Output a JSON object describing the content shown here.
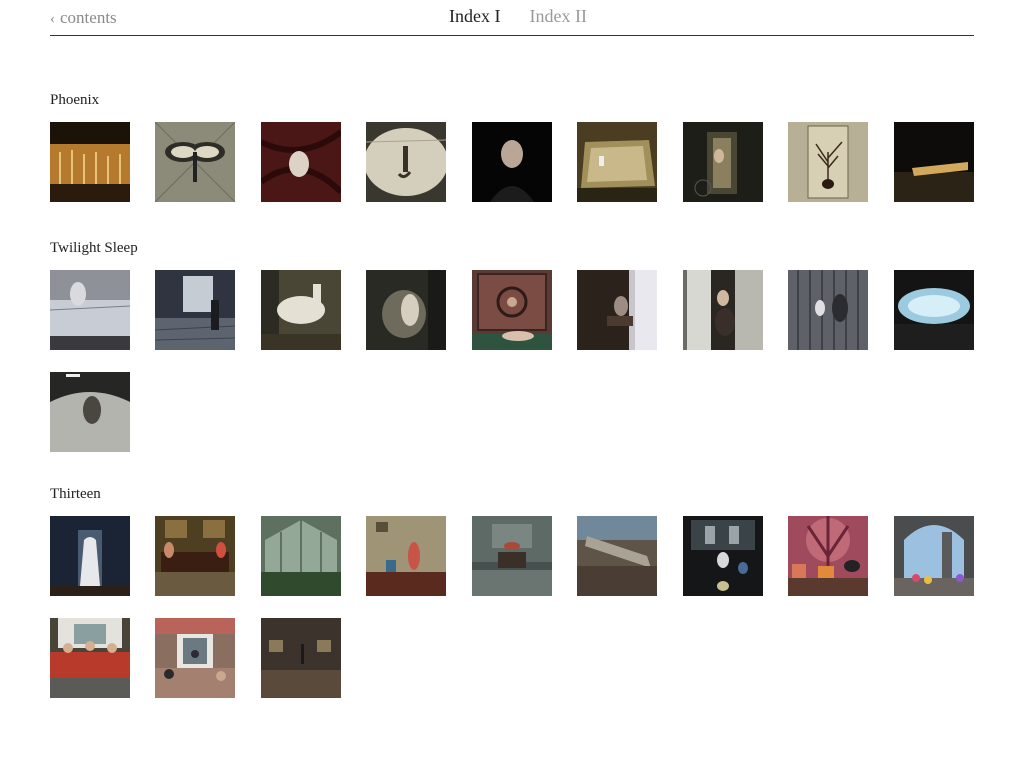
{
  "header": {
    "back_label": "contents",
    "back_icon": "chevron-left-icon",
    "tabs": [
      {
        "label": "Index I",
        "active": true
      },
      {
        "label": "Index II",
        "active": false
      }
    ]
  },
  "sections": [
    {
      "title": "Phoenix",
      "count": 9
    },
    {
      "title": "Twilight Sleep",
      "count": 10
    },
    {
      "title": "Thirteen",
      "count": 12
    }
  ]
}
